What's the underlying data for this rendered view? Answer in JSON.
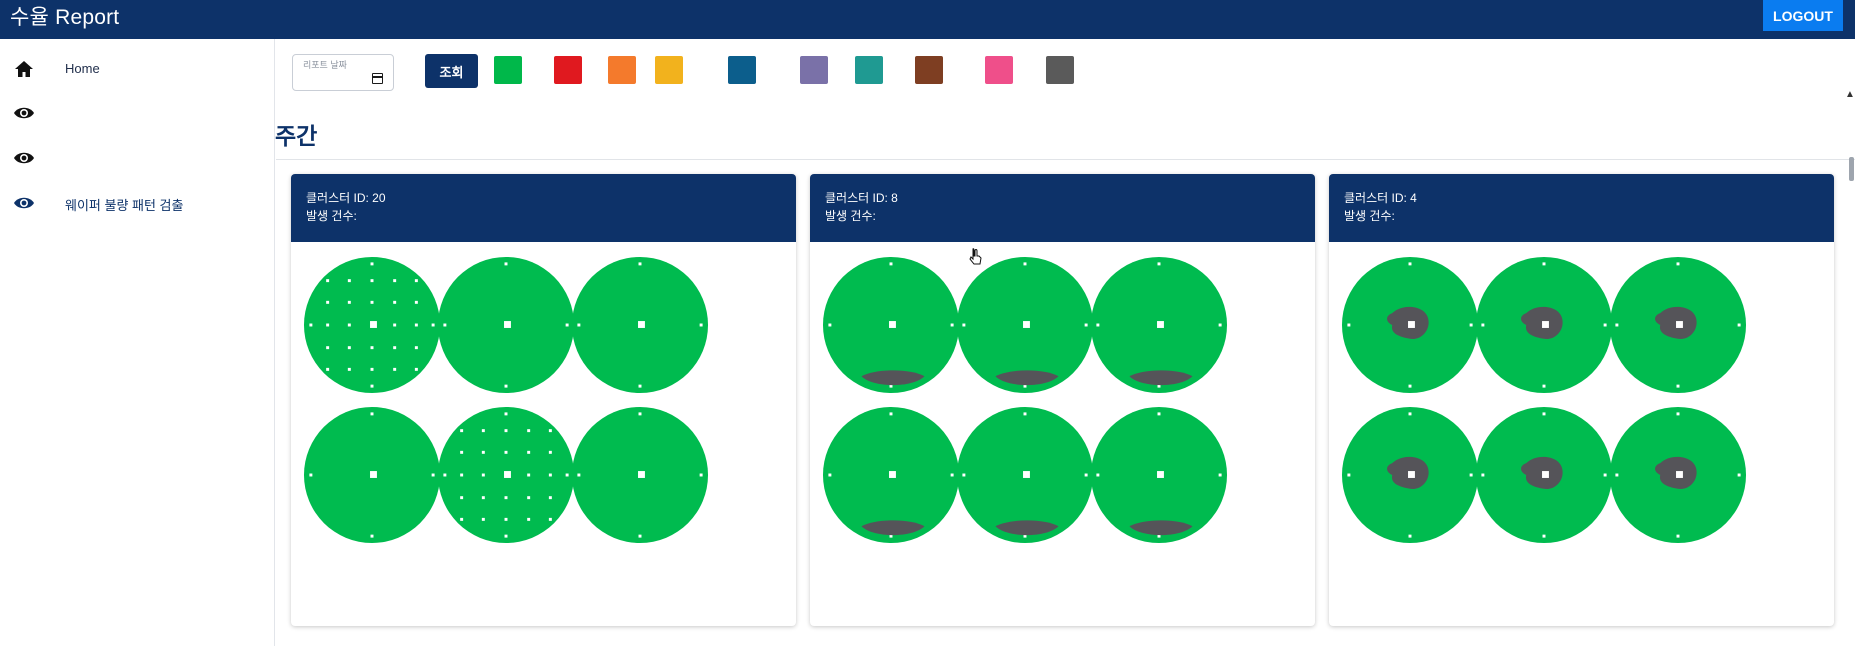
{
  "header": {
    "title": "수율 Report",
    "logout_label": "LOGOUT"
  },
  "sidebar": {
    "items": [
      {
        "label": "Home",
        "icon": "home-icon"
      },
      {
        "label": "",
        "icon": "eye-icon"
      },
      {
        "label": "",
        "icon": "eye-icon"
      },
      {
        "label": "웨이퍼 불량 패턴 검출",
        "icon": "eye-icon"
      }
    ]
  },
  "toolbar": {
    "date_label": "리포트 날짜",
    "query_label": "조회",
    "swatches": [
      "#00b84a",
      "#e0191f",
      "#f47a2c",
      "#f2b21d",
      "#0c5e8c",
      "#7a71a8",
      "#1f9a92",
      "#7e3e22",
      "#ef4f8a",
      "#5a5a5a"
    ]
  },
  "section": {
    "title": "주간"
  },
  "colors": {
    "wafer_fill": "#00bb4f",
    "defect": "#555459",
    "header": "#0d3269",
    "accent": "#0a7cf0"
  },
  "clusters": [
    {
      "id_label": "클러스터 ID: 20",
      "count_label": "발생 건수:"
    },
    {
      "id_label": "클러스터 ID: 8",
      "count_label": "발생 건수:"
    },
    {
      "id_label": "클러스터 ID: 4",
      "count_label": "발생 건수:"
    }
  ]
}
